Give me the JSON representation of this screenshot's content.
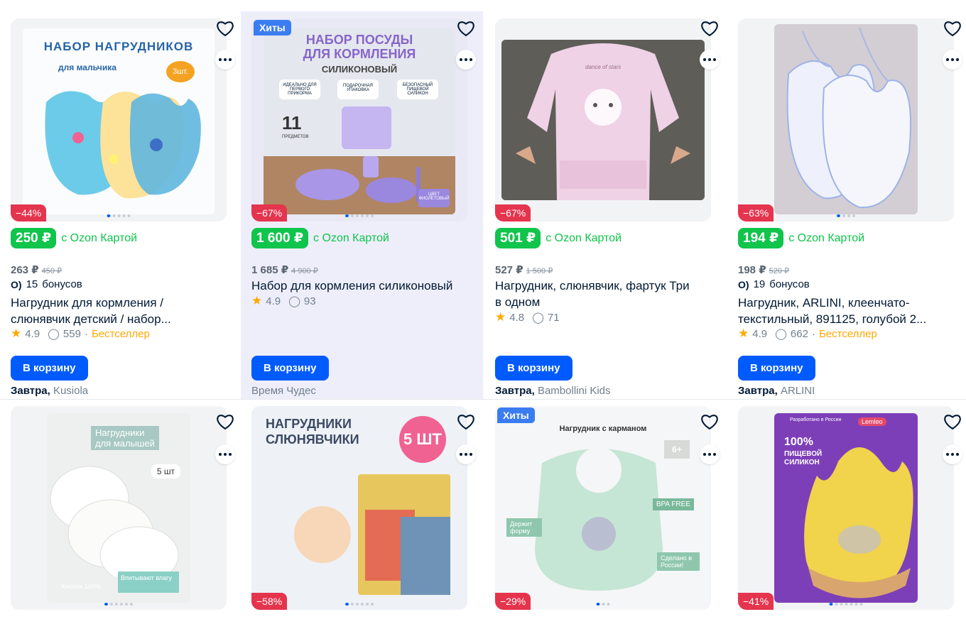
{
  "colors": {
    "accent": "#005bff",
    "price": "#10c44c",
    "discount": "#e5344d",
    "bestseller": "#ffa800",
    "hit": "#3b7cf0"
  },
  "ui": {
    "cart_button": "В корзину",
    "ozon_card": "с Ozon Картой",
    "bonus_suffix": "бонусов",
    "bestseller": "Бестселлер",
    "hit_badge": "Хиты",
    "tomorrow": "Завтра,"
  },
  "products": [
    {
      "image_text": {
        "line1": "НАБОР НАГРУДНИКОВ",
        "line2": "для мальчика",
        "tag": "3шт."
      },
      "discount": "−44%",
      "price": "250 ₽",
      "price_old": "263 ₽",
      "price_orig": "450 ₽",
      "bonus": "15",
      "title_line1": "Нагрудник для кормления /",
      "title_line2": "слюнявчик детский / набор...",
      "rating": "4.9",
      "reviews": "559",
      "seller": "Kusiola"
    },
    {
      "image_text": {
        "line1": "НАБОР ПОСУДЫ",
        "line2": "ДЛЯ КОРМЛЕНИЯ",
        "line3": "СИЛИКОНОВЫЙ",
        "f1": "ИДЕАЛЬНО ДЛЯ ПЕРВОГО ПРИКОРМА",
        "f2": "ПОДАРОЧНАЯ УПАКОВКА",
        "f3": "БЕЗОПАСНЫЙ ПИЩЕВОЙ СИЛИКОН",
        "count": "11",
        "count_label": "ПРЕДМЕТОВ",
        "color_tag": "ЦВЕТ ФИОЛЕТОВЫЙ"
      },
      "discount": "−67%",
      "price": "1 600 ₽",
      "price_old": "1 685 ₽",
      "price_orig": "4 900 ₽",
      "title_line1": "Набор для кормления силиконовый",
      "rating": "4.9",
      "reviews": "93",
      "seller": "Время Чудес"
    },
    {
      "image_text": {
        "shirt": "dance of stars"
      },
      "discount": "−67%",
      "price": "501 ₽",
      "price_old": "527 ₽",
      "price_orig": "1 500 ₽",
      "title_line1": "Нагрудник, слюнявчик, фартук Три",
      "title_line2": "в одном",
      "rating": "4.8",
      "reviews": "71",
      "seller": "Bambollini Kids"
    },
    {
      "discount": "−63%",
      "price": "194 ₽",
      "price_old": "198 ₽",
      "price_orig": "520 ₽",
      "bonus": "19",
      "title_line1": "Нагрудник, ARLINI, клеенчато-",
      "title_line2": "текстильный, 891125, голубой 2...",
      "rating": "4.9",
      "reviews": "662",
      "seller": "ARLINI"
    },
    {
      "image_text": {
        "line1": "Нагрудники",
        "line2": "для малышей",
        "count": "5 шт",
        "f1": "Хлопок 100%",
        "f2": "Впитывают влагу"
      }
    },
    {
      "image_text": {
        "line1": "НАГРУДНИКИ",
        "line2": "СЛЮНЯВЧИКИ",
        "count": "5 ШТ"
      },
      "discount": "−58%"
    },
    {
      "image_text": {
        "title": "Нагрудник с карманом",
        "age": "6+",
        "bpa": "BPA FREE",
        "f1": "Держит форму",
        "f2": "Сделано в России!"
      },
      "discount": "−29%"
    },
    {
      "image_text": {
        "dev": "Разработано в России",
        "brand": "Lemleo",
        "pct": "100%",
        "l1": "ПИЩЕВОЙ",
        "l2": "СИЛИКОН"
      },
      "discount": "−41%"
    }
  ]
}
